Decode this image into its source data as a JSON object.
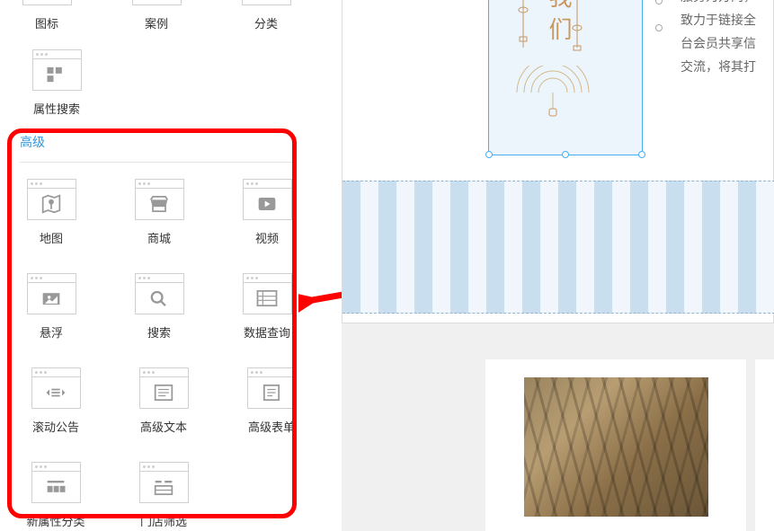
{
  "top_widgets": [
    {
      "label": "图标",
      "name": "widget-icon"
    },
    {
      "label": "案例",
      "name": "widget-case"
    },
    {
      "label": "分类",
      "name": "widget-category"
    }
  ],
  "attr_search": {
    "label": "属性搜索",
    "name": "widget-attr-search"
  },
  "section": {
    "title": "高级"
  },
  "advanced_widgets": [
    {
      "label": "地图",
      "name": "widget-map"
    },
    {
      "label": "商城",
      "name": "widget-shop"
    },
    {
      "label": "视频",
      "name": "widget-video"
    },
    {
      "label": "悬浮",
      "name": "widget-float"
    },
    {
      "label": "搜索",
      "name": "widget-search"
    },
    {
      "label": "数据查询",
      "name": "widget-data-query"
    },
    {
      "label": "滚动公告",
      "name": "widget-marquee"
    },
    {
      "label": "高级文本",
      "name": "widget-adv-text"
    },
    {
      "label": "高级表单",
      "name": "widget-adv-form"
    },
    {
      "label": "新属性分类",
      "name": "widget-new-attr-cat"
    },
    {
      "label": "门店筛选",
      "name": "widget-store-filter"
    }
  ],
  "canvas": {
    "selected_text": "我们",
    "desc_lines": [
      "服务为方向，",
      "致力于链接全",
      "台会员共享信",
      "交流，将其打"
    ],
    "colors": {
      "accent": "#46aef7",
      "gold": "#c89860",
      "red": "#ff0000"
    }
  }
}
